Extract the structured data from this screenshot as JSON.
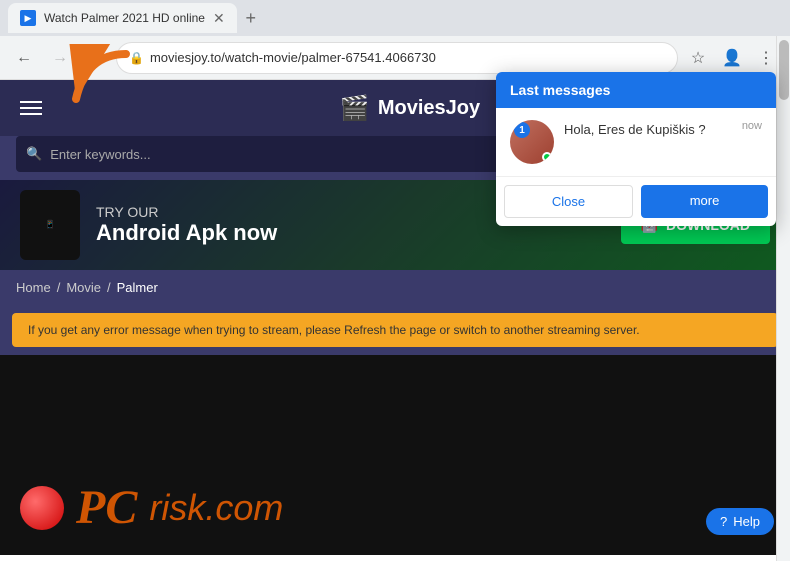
{
  "browser": {
    "tab_title": "Watch Palmer 2021 HD online",
    "tab_favicon": "▶",
    "url": "moviesjoy.to/watch-movie/palmer-67541.4066730",
    "new_tab_icon": "+",
    "back_icon": "←",
    "forward_icon": "→",
    "reload_icon": "↻",
    "star_icon": "☆",
    "account_icon": "👤",
    "menu_icon": "⋮"
  },
  "site": {
    "logo_text": "MoviesJoy",
    "logo_icon": "🎬",
    "search_placeholder": "Enter keywords...",
    "hamburger_label": "Menu"
  },
  "ad_banner": {
    "try_text": "TRY OUR",
    "app_text": "Android Apk now",
    "download_text": "DOWNLOAD",
    "android_icon": "🤖"
  },
  "breadcrumb": {
    "home": "Home",
    "separator1": "/",
    "movie": "Movie",
    "separator2": "/",
    "title": "Palmer"
  },
  "warning": {
    "text": "If you get any error message when trying to stream, please Refresh the page or switch to another streaming server."
  },
  "watermark": {
    "site_name": "PC",
    "site_suffix": "risk.com"
  },
  "help": {
    "label": "Help",
    "icon": "?"
  },
  "chat": {
    "header": "Last messages",
    "time": "now",
    "message": "Hola, Eres de Kupiškis ?",
    "user_num": "1",
    "close_label": "Close",
    "more_label": "more"
  },
  "colors": {
    "accent_blue": "#1a73e8",
    "site_bg": "#2c2c54",
    "ad_green": "#00c853",
    "warning_orange": "#f5a623"
  }
}
